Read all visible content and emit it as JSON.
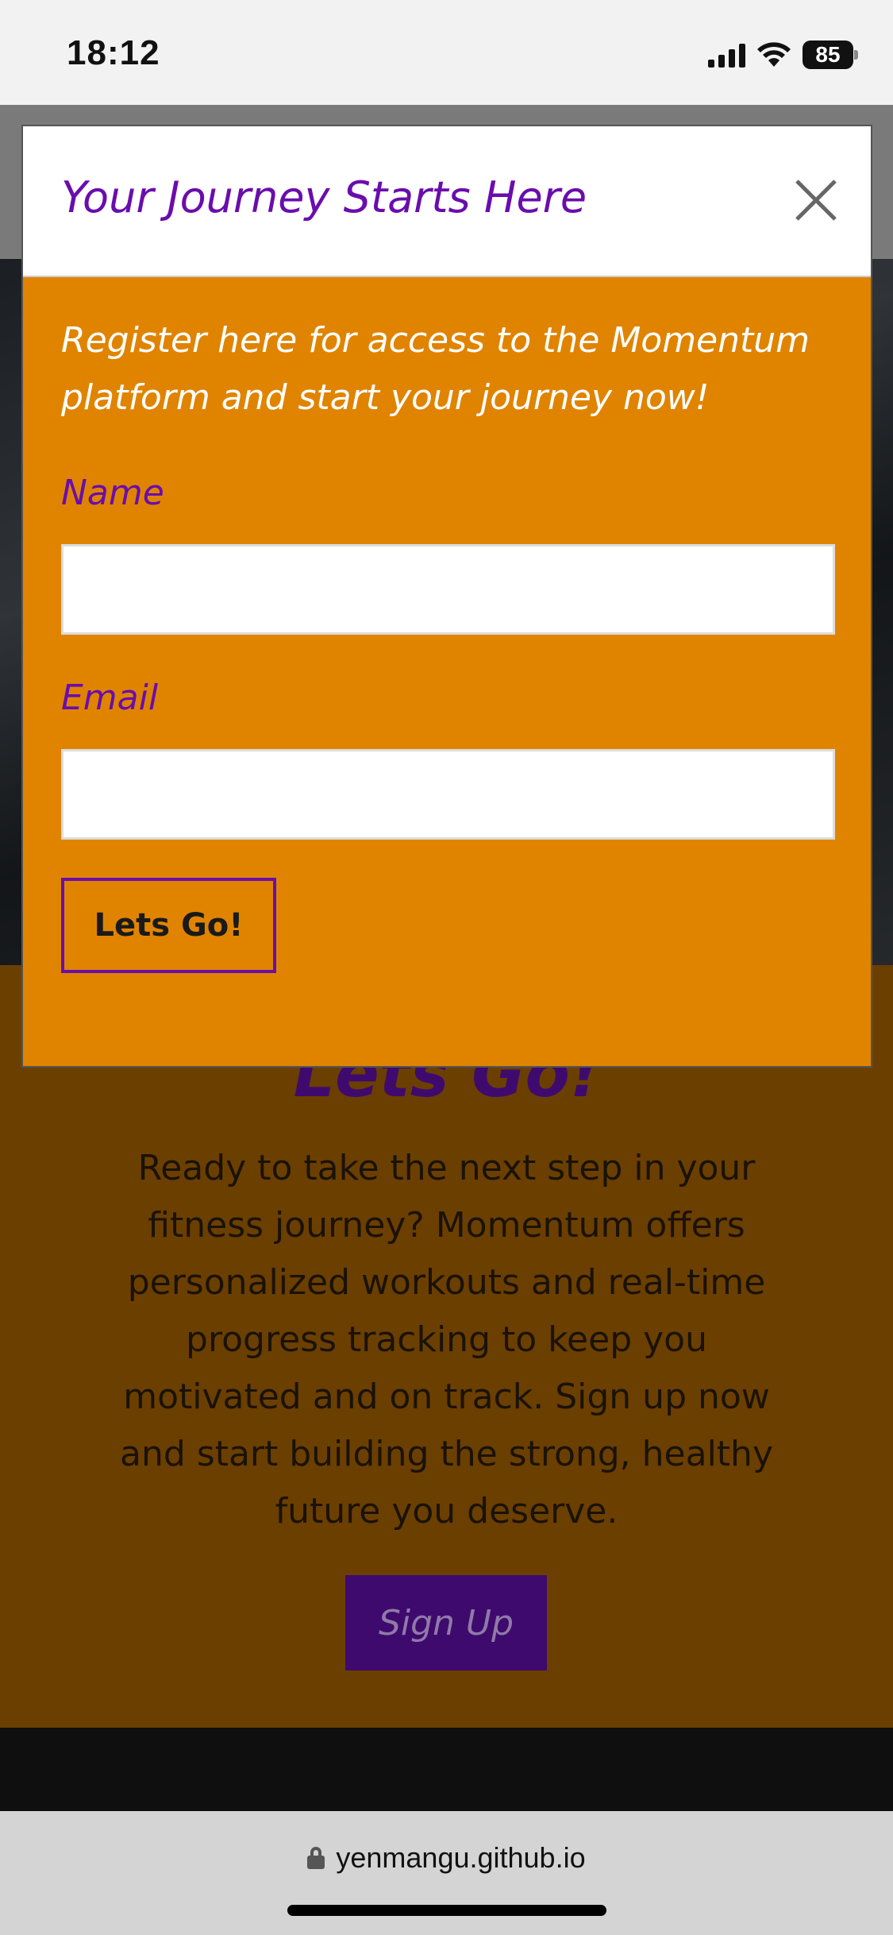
{
  "status_bar": {
    "time": "18:12",
    "battery": "85",
    "icons": [
      "signal-icon",
      "wifi-icon",
      "battery-icon"
    ]
  },
  "page": {
    "cta_heading": "Lets Go!",
    "cta_text": "Ready to take the next step in your fitness journey? Momentum offers personalized workouts and real-time progress tracking to keep you motivated and on track. Sign up now and start building the strong, healthy future you deserve.",
    "signup_button": "Sign Up"
  },
  "modal": {
    "title": "Your Journey Starts Here",
    "intro": "Register here for access to the Momentum platform and start your journey now!",
    "name_label": "Name",
    "name_value": "",
    "email_label": "Email",
    "email_value": "",
    "submit_label": "Lets Go!"
  },
  "browser": {
    "url": "yenmangu.github.io"
  },
  "colors": {
    "accent_purple": "#6a0dad",
    "modal_orange": "#e08400",
    "page_brown": "#6b3f00",
    "dark_purple": "#3f0a6e"
  }
}
